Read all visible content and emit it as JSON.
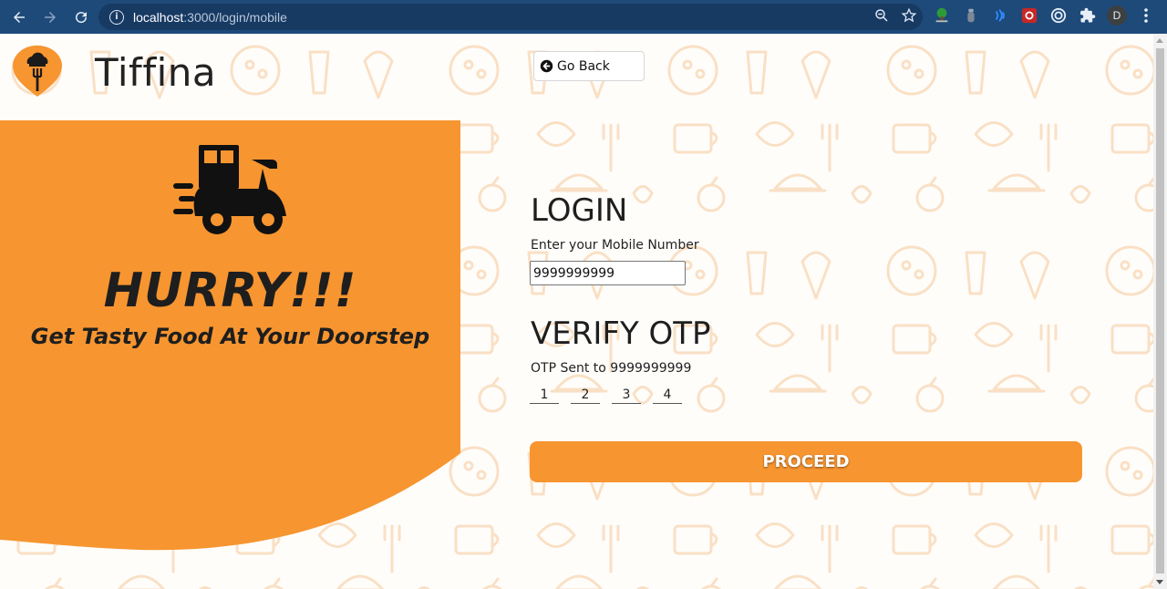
{
  "browser": {
    "url_host": "localhost",
    "url_path": ":3000/login/mobile",
    "profile_initial": "D"
  },
  "header": {
    "brand": "Tiffina",
    "go_back_label": "Go Back"
  },
  "promo": {
    "headline": "HURRY!!!",
    "tagline": "Get Tasty Food At Your Doorstep"
  },
  "login": {
    "title": "LOGIN",
    "mobile_label": "Enter your Mobile Number",
    "mobile_value": "9999999999"
  },
  "otp": {
    "title": "VERIFY OTP",
    "sent_text": "OTP Sent to 9999999999",
    "digits": [
      "1",
      "2",
      "3",
      "4"
    ]
  },
  "proceed_label": "PROCEED",
  "colors": {
    "accent": "#f79530",
    "chrome": "#1e4a7a",
    "text": "#1e1e1e"
  }
}
